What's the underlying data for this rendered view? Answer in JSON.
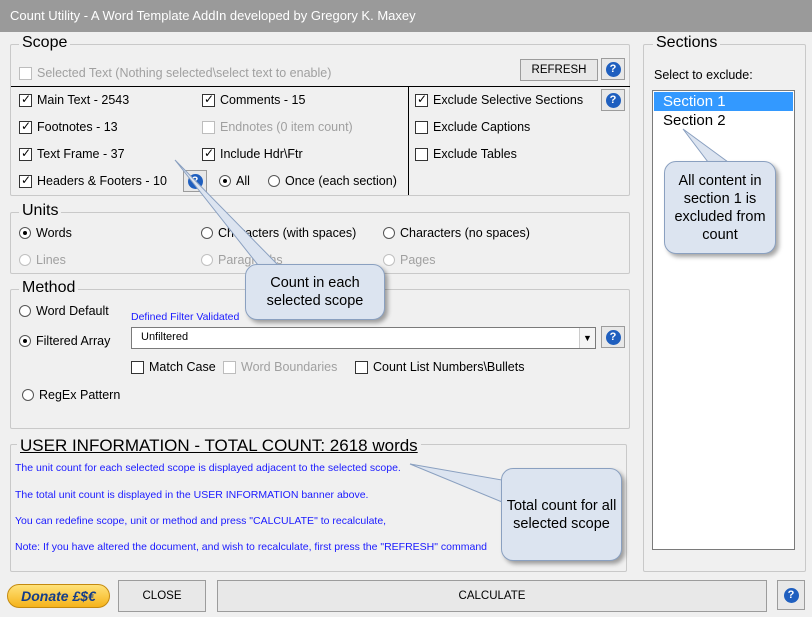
{
  "window": {
    "title": "Count Utility - A Word Template AddIn developed by Gregory K. Maxey"
  },
  "scope": {
    "legend": "Scope",
    "selected_text": "Selected Text (Nothing selected\\select text to enable)",
    "refresh_label": "REFRESH",
    "main_text": "Main Text - 2543",
    "footnotes": "Footnotes - 13",
    "text_frame": "Text Frame - 37",
    "headers_footers": "Headers & Footers - 10",
    "comments": "Comments - 15",
    "endnotes": "Endnotes (0 item count)",
    "include_hdr_ftr": "Include Hdr\\Ftr",
    "all": "All",
    "once": "Once (each section)",
    "exclude_selective": "Exclude Selective Sections",
    "exclude_captions": "Exclude Captions",
    "exclude_tables": "Exclude Tables"
  },
  "units": {
    "legend": "Units",
    "words": "Words",
    "chars_spaces": "Characters (with spaces)",
    "chars_no_spaces": "Characters (no spaces)",
    "lines": "Lines",
    "paragraphs": "Paragraphs",
    "pages": "Pages"
  },
  "method": {
    "legend": "Method",
    "word_default": "Word Default",
    "filtered_array": "Filtered Array",
    "filter_label": "Defined Filter Validated",
    "filter_value": "Unfiltered",
    "match_case": "Match Case",
    "word_boundaries": "Word Boundaries",
    "count_list": "Count List Numbers\\Bullets",
    "regex": "RegEx Pattern"
  },
  "user_info": {
    "banner": "USER INFORMATION - TOTAL COUNT: 2618 words",
    "lines": [
      "The unit count for each selected scope is displayed adjacent to the selected scope.",
      "The total unit count is displayed in the USER INFORMATION banner above.",
      "You can redefine scope, unit or method and press \"CALCULATE\" to recalculate,",
      "Note: If you have altered the document, and wish to recalculate, first press the \"REFRESH\" command"
    ]
  },
  "sections": {
    "legend": "Sections",
    "prompt": "Select to exclude:",
    "items": [
      "Section 1",
      "Section 2"
    ]
  },
  "callouts": {
    "scope": "Count in each selected scope",
    "section": "All content in section 1 is excluded from count",
    "total": "Total count for all selected scope"
  },
  "footer": {
    "donate": "Donate £$€",
    "close": "CLOSE",
    "calculate": "CALCULATE"
  },
  "colors": {
    "accent": "#1f5fbf",
    "selection": "#3399ff",
    "info_text": "#1a1aff",
    "callout_fill": "#dce4f0"
  }
}
